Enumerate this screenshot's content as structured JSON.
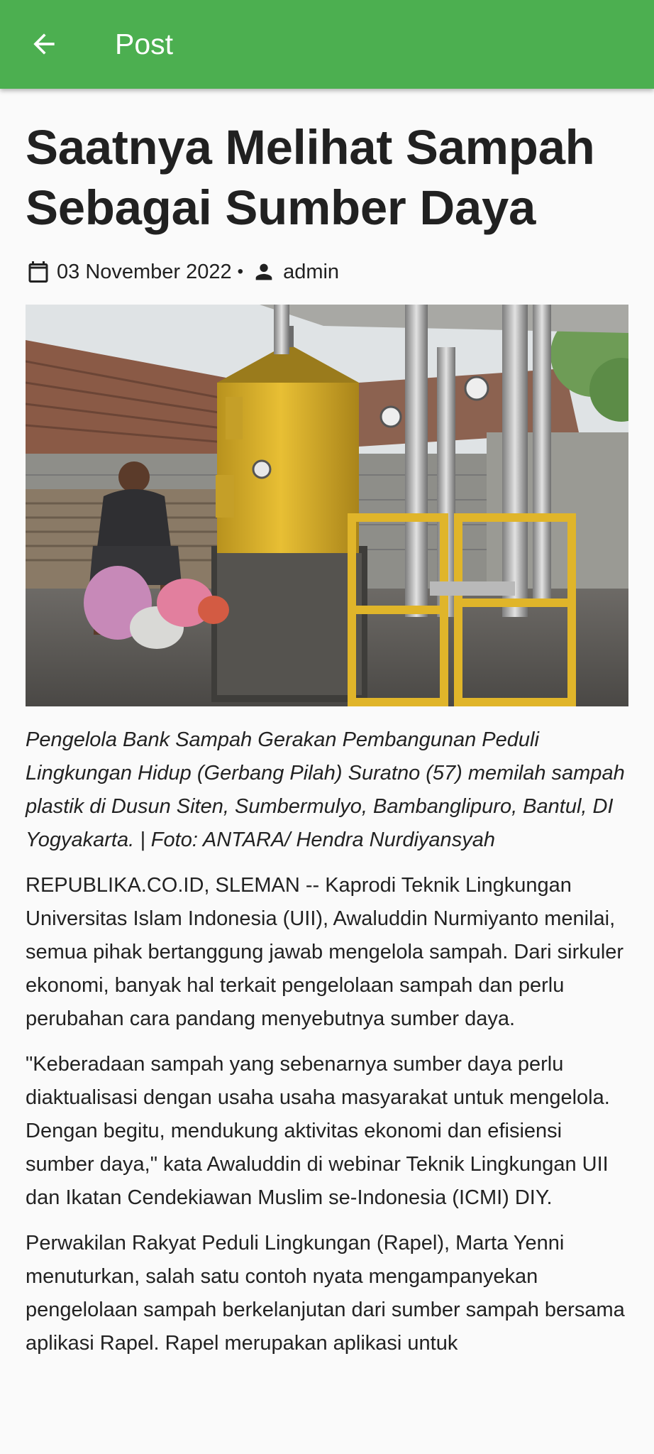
{
  "appbar": {
    "title": "Post",
    "back_icon": "arrow-left-icon",
    "color": "#4caf50"
  },
  "post": {
    "title": "Saatnya Melihat Sampah Sebagai Sumber Daya",
    "date": "03 November 2022",
    "separator": "•",
    "author": "admin",
    "date_icon": "calendar-icon",
    "author_icon": "person-icon",
    "image_icon": "photo",
    "caption": "Pengelola Bank Sampah Gerakan Pembangunan Peduli Lingkungan Hidup (Gerbang Pilah) Suratno (57) memilah sampah plastik di Dusun Siten, Sumbermulyo, Bambanglipuro, Bantul, DI Yogyakarta. | Foto: ANTARA/ Hendra Nurdiyansyah",
    "paragraphs": [
      "REPUBLIKA.CO.ID, SLEMAN -- Kaprodi Teknik Lingkungan Universitas Islam Indonesia (UII), Awaluddin Nurmiyanto menilai, semua pihak bertanggung jawab mengelola sampah. Dari sirkuler ekonomi, banyak hal terkait pengelolaan sampah dan perlu perubahan cara pandang menyebutnya sumber daya.",
      "\"Keberadaan sampah yang sebenarnya sumber daya perlu diaktualisasi dengan usaha usaha masyarakat untuk mengelola. Dengan begitu, mendukung aktivitas ekonomi dan efisiensi sumber daya,\" kata Awaluddin di webinar Teknik Lingkungan UII dan Ikatan Cendekiawan Muslim se-Indonesia (ICMI) DIY.",
      "Perwakilan Rakyat Peduli Lingkungan (Rapel), Marta Yenni menuturkan, salah satu contoh nyata mengampanyekan pengelolaan sampah berkelanjutan dari sumber sampah bersama aplikasi Rapel. Rapel merupakan aplikasi untuk"
    ]
  }
}
